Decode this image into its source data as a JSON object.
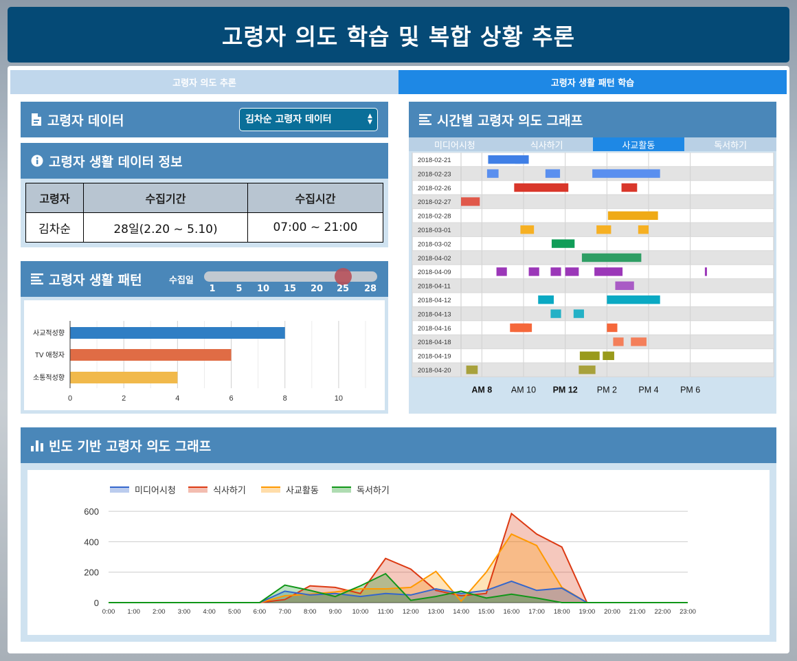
{
  "header": {
    "title": "고령자 의도 학습 및 복합 상황 추론"
  },
  "tabs": [
    {
      "label": "고령자 의도 추론",
      "active": false
    },
    {
      "label": "고령자 생활 패턴 학습",
      "active": true
    }
  ],
  "data_panel": {
    "title": "고령자 데이터",
    "icon": "file-icon",
    "select_value": "김차순 고령자 데이터"
  },
  "info_panel": {
    "title": "고령자 생활 데이터 정보",
    "icon": "info-icon",
    "headers": [
      "고령자",
      "수집기간",
      "수집시간"
    ],
    "row": [
      "김차순",
      "28일(2.20 ~ 5.10)",
      "07:00 ~ 21:00"
    ]
  },
  "pattern_panel": {
    "title": "고령자 생활 패턴",
    "icon": "list-icon",
    "slider": {
      "label": "수집일",
      "ticks": [
        "1",
        "5",
        "10",
        "15",
        "20",
        "25",
        "28"
      ],
      "value": 25
    }
  },
  "timeline_panel": {
    "title": "시간별 고령자 의도 그래프",
    "icon": "list-icon",
    "tabs": [
      "미디어시청",
      "식사하기",
      "사교활동",
      "독서하기"
    ],
    "active_tab": 2
  },
  "freq_panel": {
    "title": "빈도 기반 고령자 의도 그래프",
    "icon": "bar-chart-icon"
  },
  "colors": {
    "header": "#054a76",
    "panel_head": "#4a87b9",
    "tab_active": "#1e88e5",
    "tab_inactive": "#c0d7ec",
    "bar_blue": "#2f7ec4",
    "bar_red": "#e06c45",
    "bar_yellow": "#f1b94b"
  },
  "chart_data": [
    {
      "type": "bar",
      "orientation": "horizontal",
      "categories": [
        "사교적성향",
        "TV 애청자",
        "소통적성향"
      ],
      "values": [
        8,
        6,
        4
      ],
      "colors": [
        "#2f7ec4",
        "#e06c45",
        "#f1b94b"
      ],
      "xlim": [
        0,
        11
      ],
      "xticks": [
        "0",
        "2",
        "4",
        "6",
        "8",
        "10"
      ],
      "grid": true
    },
    {
      "type": "bar",
      "subtype": "timeline",
      "dates": [
        "2018-02-21",
        "2018-02-23",
        "2018-02-26",
        "2018-02-27",
        "2018-02-28",
        "2018-03-01",
        "2018-03-02",
        "2018-04-02",
        "2018-04-09",
        "2018-04-11",
        "2018-04-12",
        "2018-04-13",
        "2018-04-16",
        "2018-04-18",
        "2018-04-19",
        "2018-04-20"
      ],
      "row_colors": [
        "#3f7fe6",
        "#5a8fef",
        "#d9372b",
        "#e0584a",
        "#efaa16",
        "#f6b023",
        "#109d58",
        "#2e9e64",
        "#9b37b8",
        "#a95bc5",
        "#0aa9c3",
        "#24b1c6",
        "#f5683b",
        "#f47f5a",
        "#999a1c",
        "#a8a13c"
      ],
      "intervals": [
        [
          [
            8.3,
            9.85
          ],
          [
            9.6,
            10.25
          ]
        ],
        [
          [
            8.25,
            8.8
          ],
          [
            11.05,
            11.75
          ],
          [
            13.3,
            16.55
          ]
        ],
        [
          [
            9.55,
            12.15
          ],
          [
            14.7,
            15.45
          ]
        ],
        [
          [
            7.0,
            7.9
          ]
        ],
        [
          [
            14.05,
            16.45
          ]
        ],
        [
          [
            9.85,
            10.5
          ],
          [
            13.5,
            14.2
          ],
          [
            15.5,
            16.0
          ]
        ],
        [
          [
            11.35,
            12.45
          ]
        ],
        [
          [
            12.8,
            15.65
          ]
        ],
        [
          [
            8.7,
            9.2
          ],
          [
            10.25,
            10.75
          ],
          [
            11.3,
            11.8
          ],
          [
            12.0,
            12.65
          ],
          [
            13.4,
            14.75
          ],
          [
            18.7,
            18.8
          ]
        ],
        [
          [
            14.4,
            15.3
          ]
        ],
        [
          [
            10.7,
            11.45
          ],
          [
            14.0,
            16.55
          ]
        ],
        [
          [
            11.3,
            11.8
          ],
          [
            12.4,
            12.9
          ]
        ],
        [
          [
            9.35,
            10.25
          ],
          [
            9.55,
            10.4
          ],
          [
            14.0,
            14.5
          ]
        ],
        [
          [
            14.3,
            14.8
          ],
          [
            15.15,
            15.9
          ]
        ],
        [
          [
            12.7,
            13.65
          ],
          [
            13.8,
            14.35
          ]
        ],
        [
          [
            7.25,
            7.8
          ],
          [
            12.65,
            13.45
          ]
        ]
      ],
      "xticks": [
        "AM 8",
        "AM 10",
        "PM 12",
        "PM 2",
        "PM 4",
        "PM 6"
      ],
      "xtick_hours": [
        8,
        10,
        12,
        14,
        16,
        18
      ],
      "xlim": [
        7,
        22
      ]
    },
    {
      "type": "area",
      "x": [
        "0:00",
        "1:00",
        "2:00",
        "3:00",
        "4:00",
        "5:00",
        "6:00",
        "7:00",
        "8:00",
        "9:00",
        "10:00",
        "11:00",
        "12:00",
        "13:00",
        "14:00",
        "15:00",
        "16:00",
        "17:00",
        "18:00",
        "19:00",
        "20:00",
        "21:00",
        "22:00",
        "23:00"
      ],
      "ylim": [
        0,
        650
      ],
      "yticks": [
        "0",
        "200",
        "400",
        "600"
      ],
      "series": [
        {
          "name": "미디어시청",
          "color": "#3366cc",
          "values": [
            0,
            0,
            0,
            0,
            0,
            0,
            0,
            75,
            50,
            60,
            40,
            60,
            50,
            90,
            60,
            80,
            140,
            80,
            95,
            0,
            0,
            0,
            0,
            0
          ]
        },
        {
          "name": "식사하기",
          "color": "#dc3912",
          "values": [
            0,
            0,
            0,
            0,
            0,
            0,
            0,
            20,
            110,
            100,
            60,
            290,
            220,
            80,
            45,
            60,
            585,
            450,
            365,
            0,
            0,
            0,
            0,
            0
          ]
        },
        {
          "name": "사교활동",
          "color": "#ff9900",
          "values": [
            0,
            0,
            0,
            0,
            0,
            0,
            0,
            45,
            55,
            70,
            90,
            90,
            100,
            205,
            10,
            200,
            450,
            375,
            100,
            0,
            0,
            0,
            0,
            0
          ]
        },
        {
          "name": "독서하기",
          "color": "#109618",
          "values": [
            0,
            0,
            0,
            0,
            0,
            0,
            0,
            115,
            80,
            40,
            110,
            190,
            15,
            40,
            75,
            30,
            55,
            30,
            0,
            0,
            0,
            0,
            0,
            0
          ]
        }
      ]
    }
  ]
}
